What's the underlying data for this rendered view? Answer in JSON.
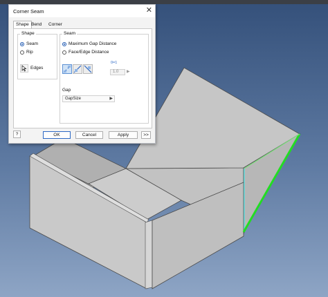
{
  "dialog": {
    "title": "Corner Seam",
    "close_glyph": "✕",
    "tabs": [
      {
        "label": "Shape",
        "active": true
      },
      {
        "label": "Bend",
        "active": false
      },
      {
        "label": "Corner",
        "active": false
      }
    ],
    "shape_group": {
      "title": "Shape",
      "options": [
        {
          "label": "Seam",
          "selected": true
        },
        {
          "label": "Rip",
          "selected": false
        }
      ],
      "edges_label": "Edges"
    },
    "seam_group": {
      "title": "Seam",
      "options": [
        {
          "label": "Maximum Gap Distance",
          "selected": true
        },
        {
          "label": "Face/Edge Distance",
          "selected": false
        }
      ],
      "ratio_value": "1.0",
      "ratio_icon_label": "0=1"
    },
    "gap": {
      "label": "Gap",
      "value": "GapSize"
    },
    "buttons": {
      "ok": "OK",
      "cancel": "Cancel",
      "apply": "Apply",
      "more": ">>"
    },
    "help_glyph": "?"
  },
  "colors": {
    "accent": "#1a56b0",
    "selected_edge": "#22dd22",
    "selected_edge_alt": "#5fe0e0"
  }
}
